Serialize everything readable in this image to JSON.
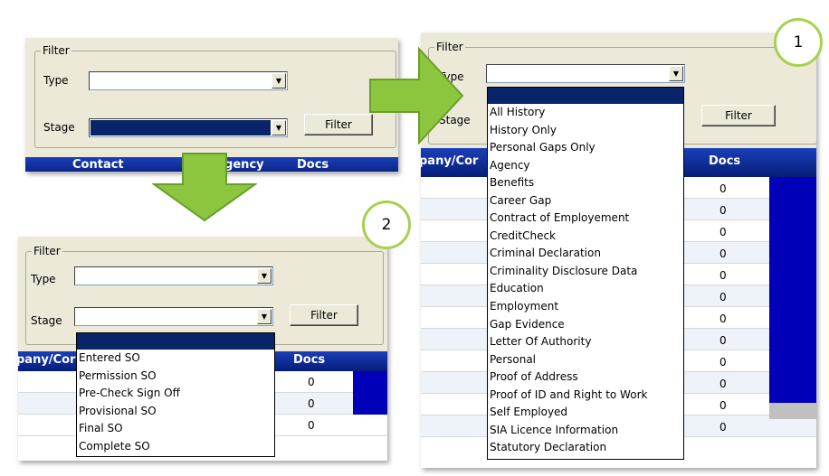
{
  "top_left": {
    "filter_legend": "Filter",
    "type_label": "Type",
    "stage_label": "Stage",
    "filter_button": "Filter",
    "headers": [
      "Contact",
      "Agency",
      "Docs"
    ]
  },
  "bottom_left": {
    "filter_legend": "Filter",
    "type_label": "Type",
    "stage_label": "Stage",
    "filter_button": "Filter",
    "headers": [
      "pany/Cor",
      "Docs"
    ],
    "docs": [
      "0",
      "0",
      "0"
    ],
    "stage_options": [
      "Entered SO",
      "Permission SO",
      "Pre-Check Sign Off",
      "Provisional SO",
      "Final SO",
      "Complete SO"
    ]
  },
  "right": {
    "filter_legend": "Filter",
    "type_label": "Type",
    "stage_label": "Stage",
    "filter_button": "Filter",
    "headers": [
      "pany/Cor",
      "Docs"
    ],
    "docs": [
      "0",
      "0",
      "0",
      "0",
      "0",
      "0",
      "0",
      "0",
      "0",
      "0",
      "0",
      "0"
    ],
    "type_options": [
      "All History",
      "History Only",
      "Personal Gaps Only",
      "Agency",
      "Benefits",
      "Career Gap",
      "Contract of Employement",
      "CreditCheck",
      "Criminal Declaration",
      "Criminality Disclosure Data",
      "Education",
      "Employment",
      "Gap Evidence",
      "Letter Of Authority",
      "Personal",
      "Proof of Address",
      "Proof of ID and Right to Work",
      "Self Employed",
      "SIA Licence Information",
      "Statutory Declaration"
    ]
  },
  "callouts": {
    "one": "1",
    "two": "2"
  },
  "colors": {
    "arrow": "#8cc63f",
    "callout_ring": "#a6d14e",
    "header": "#0a2a9a",
    "highlight": "#0a246a"
  },
  "icons": {
    "arrow_right": "arrow-right-icon",
    "arrow_down": "arrow-down-icon",
    "dropdown": "chevron-down-icon"
  }
}
